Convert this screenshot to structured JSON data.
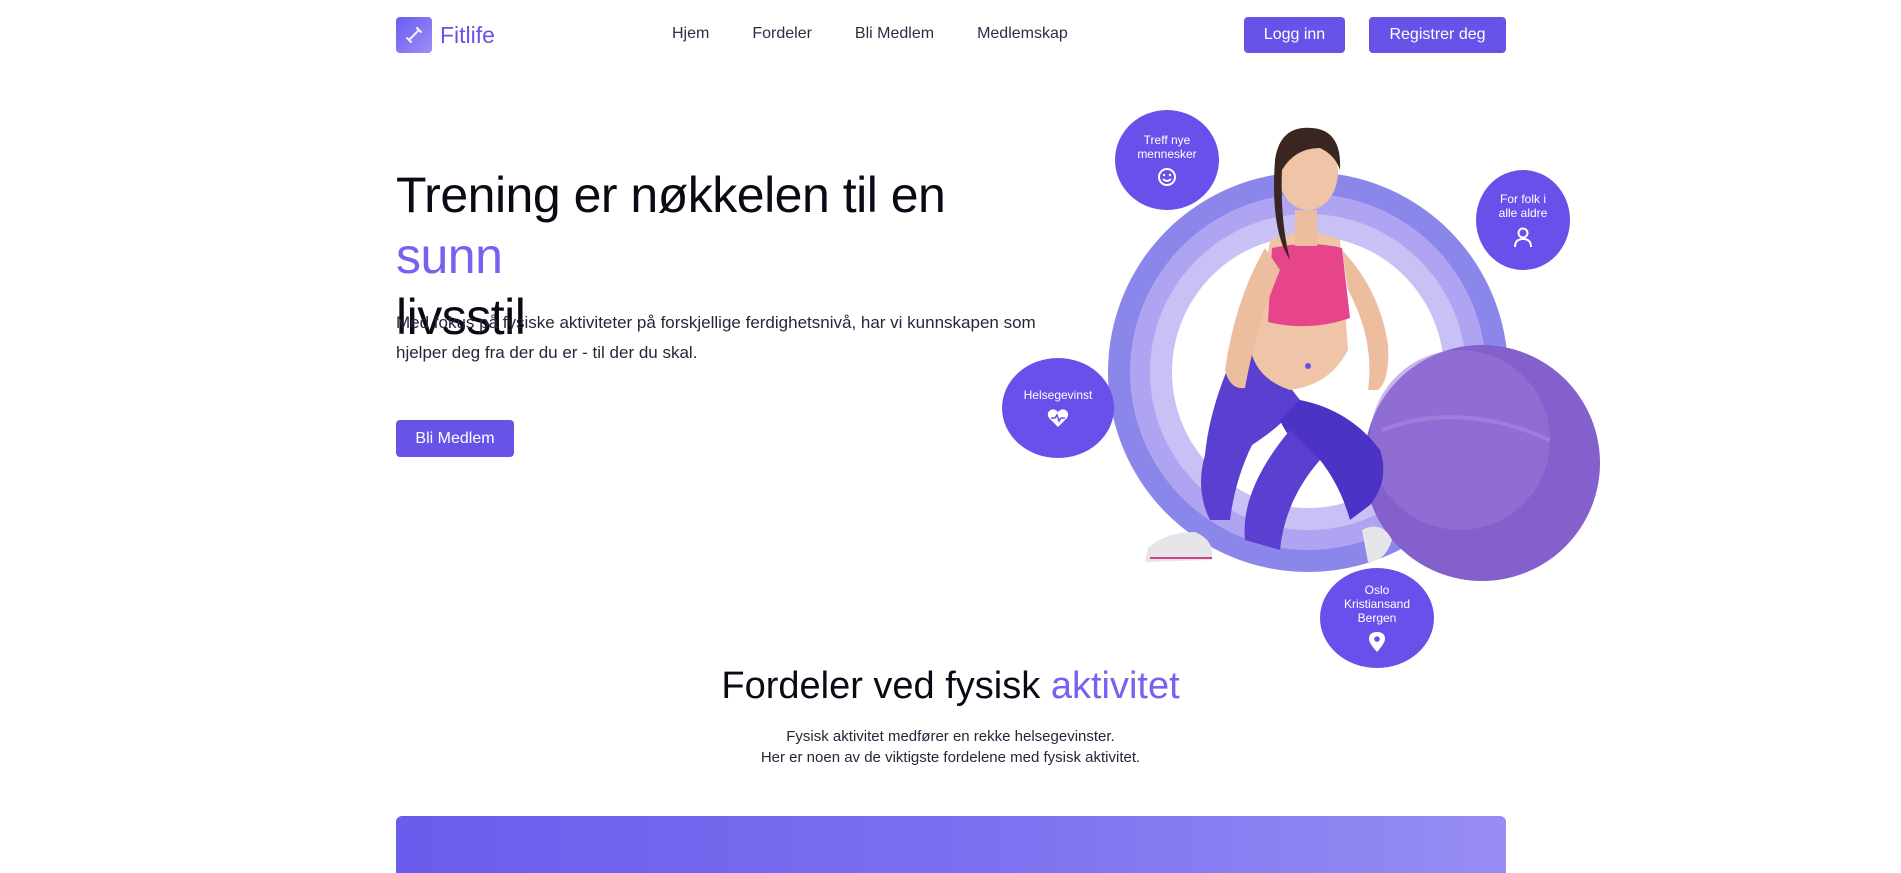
{
  "brand": {
    "name": "Fitlife",
    "accent": "#6753e8"
  },
  "nav": {
    "links": [
      "Hjem",
      "Fordeler",
      "Bli Medlem",
      "Medlemskap"
    ],
    "login_label": "Logg inn",
    "register_label": "Registrer deg"
  },
  "hero": {
    "title_part1": "Trening er nøkkelen til en ",
    "title_accent": "sunn",
    "title_part2": "livsstil",
    "text": "Med fokus på fysiske aktiviteter på forskjellige ferdighetsnivå, har vi kunnskapen som hjelper deg fra der du er - til der du skal.",
    "cta_label": "Bli Medlem"
  },
  "bubbles": {
    "meet": {
      "line1": "Treff nye",
      "line2": "mennesker",
      "icon": "smile-icon"
    },
    "ages": {
      "line1": "For folk i",
      "line2": "alle aldre",
      "icon": "user-icon"
    },
    "health": {
      "line1": "Helsegevinst",
      "icon": "heart-pulse-icon"
    },
    "locations": {
      "line1": "Oslo",
      "line2": "Kristiansand",
      "line3": "Bergen",
      "icon": "location-pin-icon"
    }
  },
  "benefits": {
    "title_part1": "Fordeler ved fysisk ",
    "title_accent": "aktivitet",
    "sub_line1": "Fysisk aktivitet medfører en rekke helsegevinster.",
    "sub_line2": "Her er noen av de viktigste fordelene med fysisk aktivitet."
  }
}
